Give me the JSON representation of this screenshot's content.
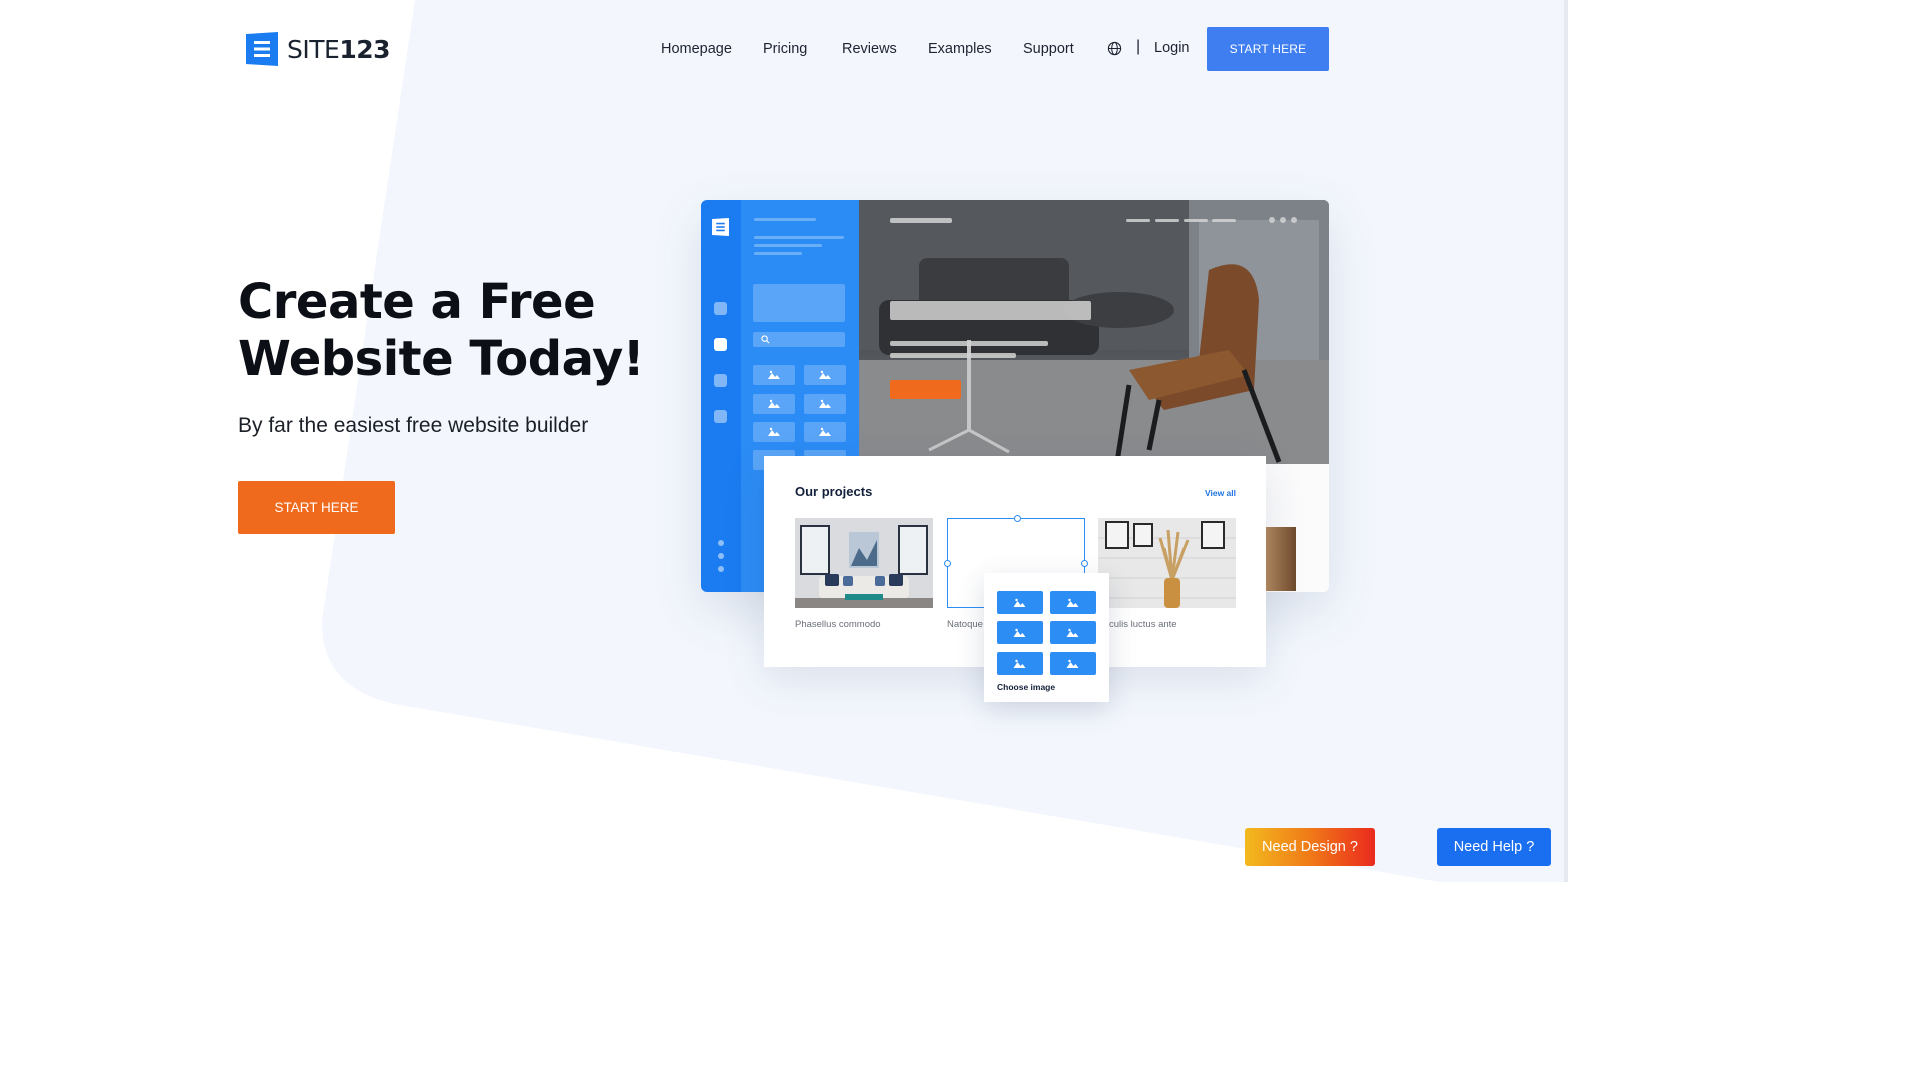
{
  "header": {
    "logo": {
      "text_light": "SITE",
      "text_bold": "123"
    },
    "nav": [
      {
        "label": "Homepage"
      },
      {
        "label": "Pricing"
      },
      {
        "label": "Reviews"
      },
      {
        "label": "Examples"
      },
      {
        "label": "Support"
      }
    ],
    "language_icon": "globe-icon",
    "separator": "|",
    "login_label": "Login",
    "start_label": "START HERE"
  },
  "hero": {
    "title": "Create a Free Website Today!",
    "subtitle": "By far the easiest free website builder",
    "cta_label": "START HERE"
  },
  "mockup": {
    "projects": {
      "title": "Our projects",
      "view_all": "View all",
      "items": [
        {
          "caption": "Phasellus commodo"
        },
        {
          "caption": "Natoque"
        },
        {
          "caption": "culis luctus ante"
        }
      ]
    },
    "chooser_label": "Choose image"
  },
  "floating": {
    "design_label": "Need Design ?",
    "help_label": "Need Help ?"
  },
  "colors": {
    "primary_blue": "#3f7ef0",
    "cta_orange": "#f06a1e",
    "help_blue": "#1a6ef0"
  }
}
